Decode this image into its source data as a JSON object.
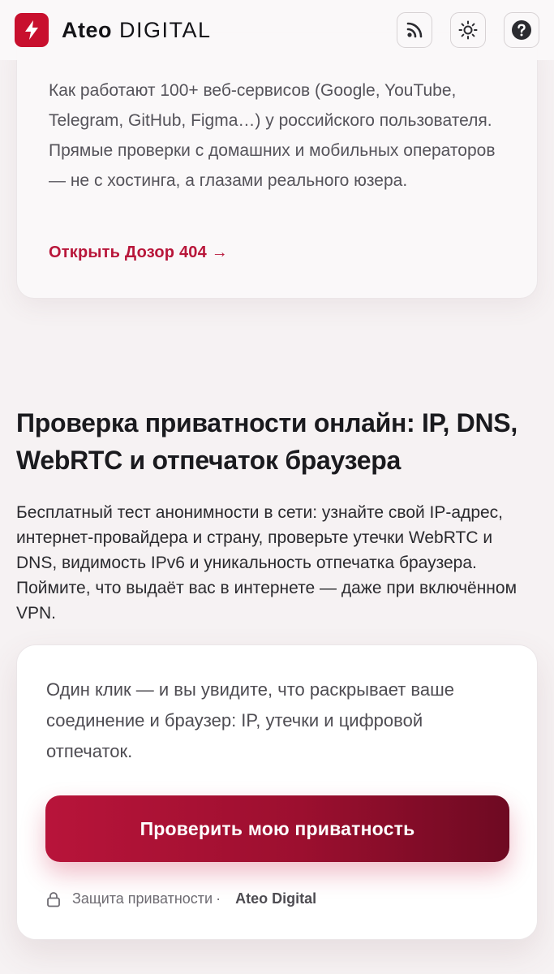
{
  "header": {
    "brand_primary": "Ateo",
    "brand_secondary": "DIGITAL",
    "logo_icon": "lightning-bolt-icon",
    "actions": [
      {
        "icon": "rss-feed-icon"
      },
      {
        "icon": "sun-theme-icon"
      },
      {
        "icon": "help-question-icon"
      }
    ]
  },
  "top_card": {
    "description": "Как работают 100+ веб-сервисов (Google, YouTube, Telegram, GitHub, Figma…) у российского пользователя. Прямые проверки с домашних и мобильных операторов — не с хостинга, а глазами реального юзера.",
    "link": "Открыть Дозор 404 →"
  },
  "section": {
    "title": "Проверка приватности онлайн: IP, DNS, WebRTC и отпечаток браузера",
    "description": "Бесплатный тест анонимности в сети: узнайте свой IP-адрес, интернет-провайдера и страну, проверьте утечки WebRTC и DNS, видимость IPv6 и уникальность отпечатка браузера. Поймите, что выдаёт вас в интернете — даже при включённом VPN."
  },
  "cta_card": {
    "text": "Один клик — и вы увидите, что раскрывает ваше соединение и браузер: IP, утечки и цифровой отпечаток.",
    "button": "Проверить мою приватность",
    "footer_label": "Защита приватности",
    "footer_sep": "·",
    "footer_brand": "Ateo Digital"
  },
  "colors": {
    "accent": "#c8102e",
    "link": "#b8163a",
    "button_gradient_end": "#6e0a22"
  }
}
